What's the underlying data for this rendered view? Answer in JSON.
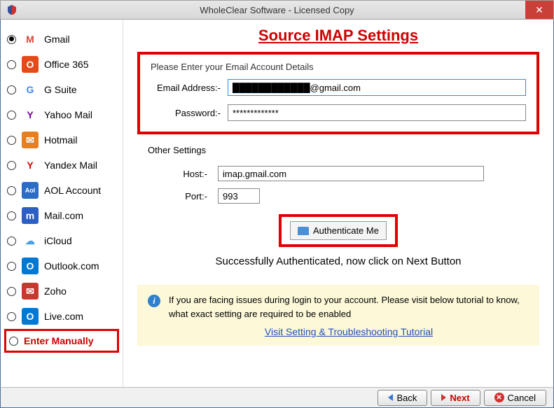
{
  "window": {
    "title": "WholeClear Software - Licensed Copy"
  },
  "sidebar": {
    "items": [
      {
        "label": "Gmail",
        "checked": true,
        "bg": "#fff",
        "fg": "#d44638",
        "text": "M"
      },
      {
        "label": "Office 365",
        "checked": false,
        "bg": "#e64a19",
        "fg": "#fff",
        "text": "O"
      },
      {
        "label": "G Suite",
        "checked": false,
        "bg": "#fff",
        "fg": "#4285f4",
        "text": "G"
      },
      {
        "label": "Yahoo Mail",
        "checked": false,
        "bg": "#fff",
        "fg": "#7b0099",
        "text": "Y"
      },
      {
        "label": "Hotmail",
        "checked": false,
        "bg": "#e67e22",
        "fg": "#fff",
        "text": "✉"
      },
      {
        "label": "Yandex Mail",
        "checked": false,
        "bg": "#fff",
        "fg": "#d00",
        "text": "Y"
      },
      {
        "label": "AOL Account",
        "checked": false,
        "bg": "#2b6cc4",
        "fg": "#fff",
        "text": "Aol"
      },
      {
        "label": "Mail.com",
        "checked": false,
        "bg": "#2b5fc4",
        "fg": "#fff",
        "text": "m"
      },
      {
        "label": "iCloud",
        "checked": false,
        "bg": "#fff",
        "fg": "#4aa0e8",
        "text": "☁"
      },
      {
        "label": "Outlook.com",
        "checked": false,
        "bg": "#0078d4",
        "fg": "#fff",
        "text": "O"
      },
      {
        "label": "Zoho",
        "checked": false,
        "bg": "#c8382e",
        "fg": "#fff",
        "text": "✉"
      },
      {
        "label": "Live.com",
        "checked": false,
        "bg": "#0078d4",
        "fg": "#fff",
        "text": "O"
      }
    ],
    "manual_label": "Enter Manually"
  },
  "main": {
    "heading": "Source IMAP Settings",
    "acct_label": "Please Enter your Email Account Details",
    "email_label": "Email Address:-",
    "email_value": "████████████@gmail.com",
    "pass_label": "Password:-",
    "pass_value": "*************",
    "other_label": "Other Settings",
    "host_label": "Host:-",
    "host_value": "imap.gmail.com",
    "port_label": "Port:-",
    "port_value": "993",
    "auth_label": "Authenticate Me",
    "status": "Successfully Authenticated, now click on Next Button",
    "info_text": "If you are facing issues during login to your account. Please visit below tutorial to know, what exact setting are required to be enabled",
    "tutorial_link": "Visit Setting & Troubleshooting Tutorial"
  },
  "footer": {
    "back": "Back",
    "next": "Next",
    "cancel": "Cancel"
  }
}
